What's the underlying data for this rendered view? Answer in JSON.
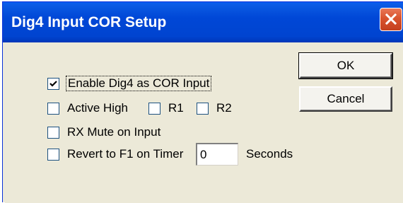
{
  "window": {
    "title": "Dig4 Input COR Setup"
  },
  "options": {
    "enable_dig4": {
      "label": "Enable Dig4 as COR Input",
      "checked": true
    },
    "active_high": {
      "label": "Active High",
      "checked": false
    },
    "r1": {
      "label": "R1",
      "checked": false
    },
    "r2": {
      "label": "R2",
      "checked": false
    },
    "rx_mute": {
      "label": "RX Mute on Input",
      "checked": false
    },
    "revert_f1": {
      "label": "Revert to F1 on Timer",
      "checked": false
    }
  },
  "timer": {
    "value": "0",
    "unit_label": "Seconds"
  },
  "buttons": {
    "ok_label": "OK",
    "cancel_label": "Cancel"
  },
  "icons": {
    "close": "close-icon",
    "check": "checkmark-icon"
  }
}
